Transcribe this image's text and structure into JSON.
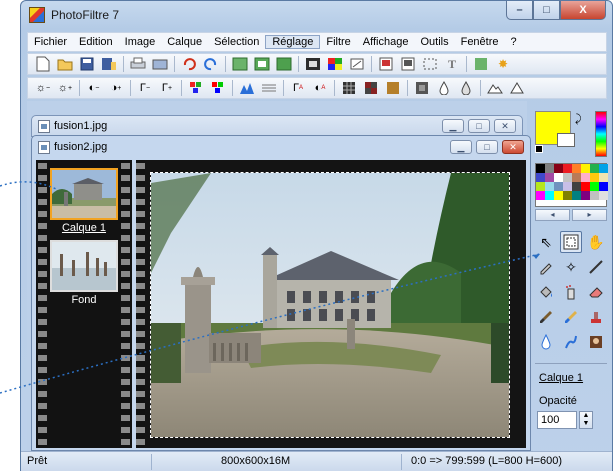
{
  "window": {
    "title": "PhotoFiltre 7",
    "caption": {
      "minimize": "–",
      "maximize": "□",
      "close": "X"
    }
  },
  "menu": [
    "Fichier",
    "Edition",
    "Image",
    "Calque",
    "Sélection",
    "Réglage",
    "Filtre",
    "Affichage",
    "Outils",
    "Fenêtre",
    "?"
  ],
  "toolbar1_icons": [
    "new-icon",
    "open-icon",
    "save-icon",
    "save-as-icon",
    "print-icon",
    "scan-icon",
    "undo-icon",
    "redo-icon",
    "paste-layer-icon",
    "copy-icon",
    "paste-icon",
    "frame-icon",
    "color-icon",
    "transform-icon",
    "image-info-icon",
    "layer-info-icon",
    "selection-icon",
    "text-icon",
    "script-icon",
    "star-icon"
  ],
  "toolbar2_icons": [
    "brightness-minus-icon",
    "brightness-plus-icon",
    "contrast-minus-icon",
    "contrast-plus-icon",
    "gamma-minus-icon",
    "gamma-plus-icon",
    "saturation-minus-icon",
    "saturation-plus-icon",
    "histogram-icon",
    "levels-icon",
    "auto-levels-icon",
    "auto-contrast-icon",
    "grid-icon",
    "mosaic-icon",
    "pattern-icon",
    "filter-icon",
    "drop-icon",
    "drop-outline-icon",
    "mountain-icon",
    "triangle-icon"
  ],
  "documents": {
    "back": {
      "title": "fusion1.jpg"
    },
    "front": {
      "title": "fusion2.jpg"
    }
  },
  "layers": [
    {
      "label": "Calque 1",
      "selected": true
    },
    {
      "label": "Fond",
      "selected": false
    }
  ],
  "panel": {
    "fg_color": "#ffff00",
    "bg_color": "#ffffff",
    "active_layer": "Calque 1",
    "opacity_label": "Opacité",
    "opacity_value": "100"
  },
  "status": {
    "state": "Prêt",
    "image_info": "800x600x16M",
    "coords": "0:0 => 799:599 (L=800  H=600)"
  }
}
